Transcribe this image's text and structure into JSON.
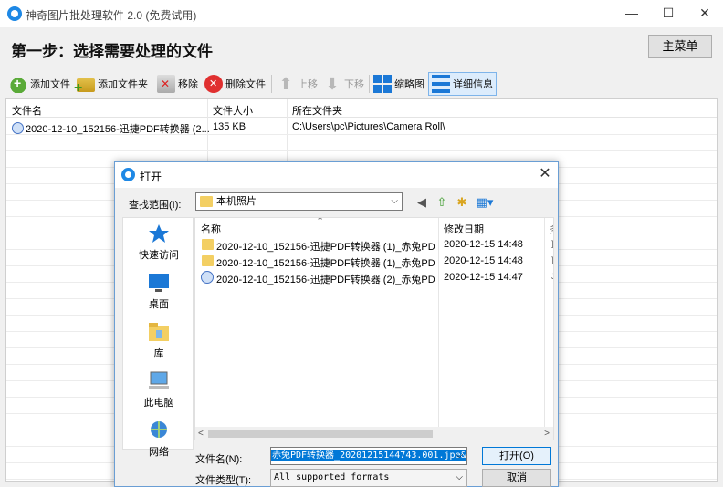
{
  "window": {
    "title": "神奇图片批处理软件 2.0 (免费试用)",
    "minimize_glyph": "—",
    "maximize_glyph": "☐",
    "close_glyph": "✕"
  },
  "step": {
    "title": "第一步：选择需要处理的文件",
    "main_menu_label": "主菜单"
  },
  "toolbar": {
    "add_file": "添加文件",
    "add_folder": "添加文件夹",
    "remove": "移除",
    "delete_file": "删除文件",
    "move_up": "上移",
    "move_down": "下移",
    "thumbnail": "缩略图",
    "details": "详细信息"
  },
  "file_list": {
    "columns": [
      "文件名",
      "文件大小",
      "所在文件夹"
    ],
    "rows": [
      {
        "name": "2020-12-10_152156-迅捷PDF转换器 (2...",
        "size": "135 KB",
        "folder": "C:\\Users\\pc\\Pictures\\Camera Roll\\"
      }
    ]
  },
  "dialog": {
    "title": "打开",
    "look_in_label": "查找范围(I):",
    "look_in_value": "本机照片",
    "places": [
      {
        "label": "快速访问",
        "icon": "star-icon"
      },
      {
        "label": "桌面",
        "icon": "desktop-icon"
      },
      {
        "label": "库",
        "icon": "library-icon"
      },
      {
        "label": "此电脑",
        "icon": "computer-icon"
      },
      {
        "label": "网络",
        "icon": "network-icon"
      }
    ],
    "columns": {
      "name": "名称",
      "date": "修改日期",
      "extra": "多"
    },
    "files": [
      {
        "name": "2020-12-10_152156-迅捷PDF转换器 (1)_赤兔PD...",
        "date": "2020-12-15 14:48",
        "type": "folder",
        "extra": "]"
      },
      {
        "name": "2020-12-10_152156-迅捷PDF转换器 (1)_赤兔PD...",
        "date": "2020-12-15 14:48",
        "type": "folder",
        "extra": "]"
      },
      {
        "name": "2020-12-10_152156-迅捷PDF转换器 (2)_赤兔PD...",
        "date": "2020-12-15 14:47",
        "type": "image",
        "extra": "J"
      }
    ],
    "file_name_label": "文件名(N):",
    "file_name_value": "赤兔PDF转换器_20201215144743.001.jpe&",
    "file_type_label": "文件类型(T):",
    "file_type_value": "All supported formats",
    "open_button": "打开(O)",
    "cancel_button": "取消"
  }
}
